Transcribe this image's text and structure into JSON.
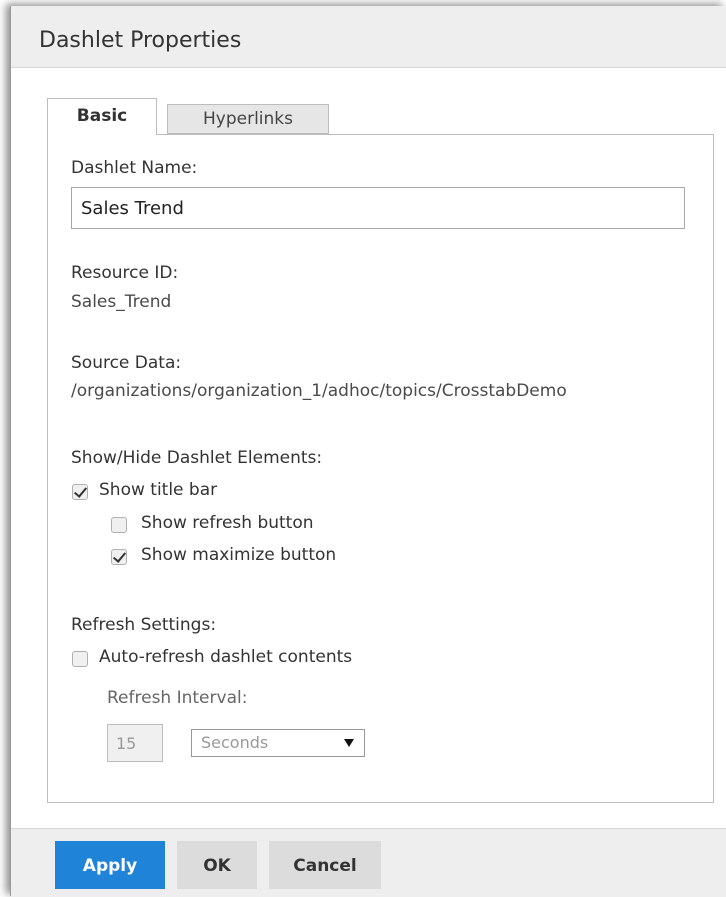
{
  "dialog": {
    "title": "Dashlet Properties"
  },
  "tabs": [
    {
      "label": "Basic",
      "active": true
    },
    {
      "label": "Hyperlinks",
      "active": false
    }
  ],
  "form": {
    "dashlet_name_label": "Dashlet Name:",
    "dashlet_name_value": "Sales Trend",
    "resource_id_label": "Resource ID:",
    "resource_id_value": "Sales_Trend",
    "source_data_label": "Source Data:",
    "source_data_value": "/organizations/organization_1/adhoc/topics/CrosstabDemo",
    "show_hide_label": "Show/Hide Dashlet Elements:",
    "show_title_bar": {
      "label": "Show title bar",
      "checked": true
    },
    "show_refresh_button": {
      "label": "Show refresh button",
      "checked": false
    },
    "show_maximize_button": {
      "label": "Show maximize button",
      "checked": true
    },
    "refresh_settings_label": "Refresh Settings:",
    "auto_refresh": {
      "label": "Auto-refresh dashlet contents",
      "checked": false
    },
    "refresh_interval_label": "Refresh Interval:",
    "refresh_interval_value": "15",
    "refresh_unit_selected": "Seconds"
  },
  "footer": {
    "apply_label": "Apply",
    "ok_label": "OK",
    "cancel_label": "Cancel"
  },
  "colors": {
    "primary_button": "#1f84d8",
    "titlebar_bg": "#eeeeee"
  }
}
